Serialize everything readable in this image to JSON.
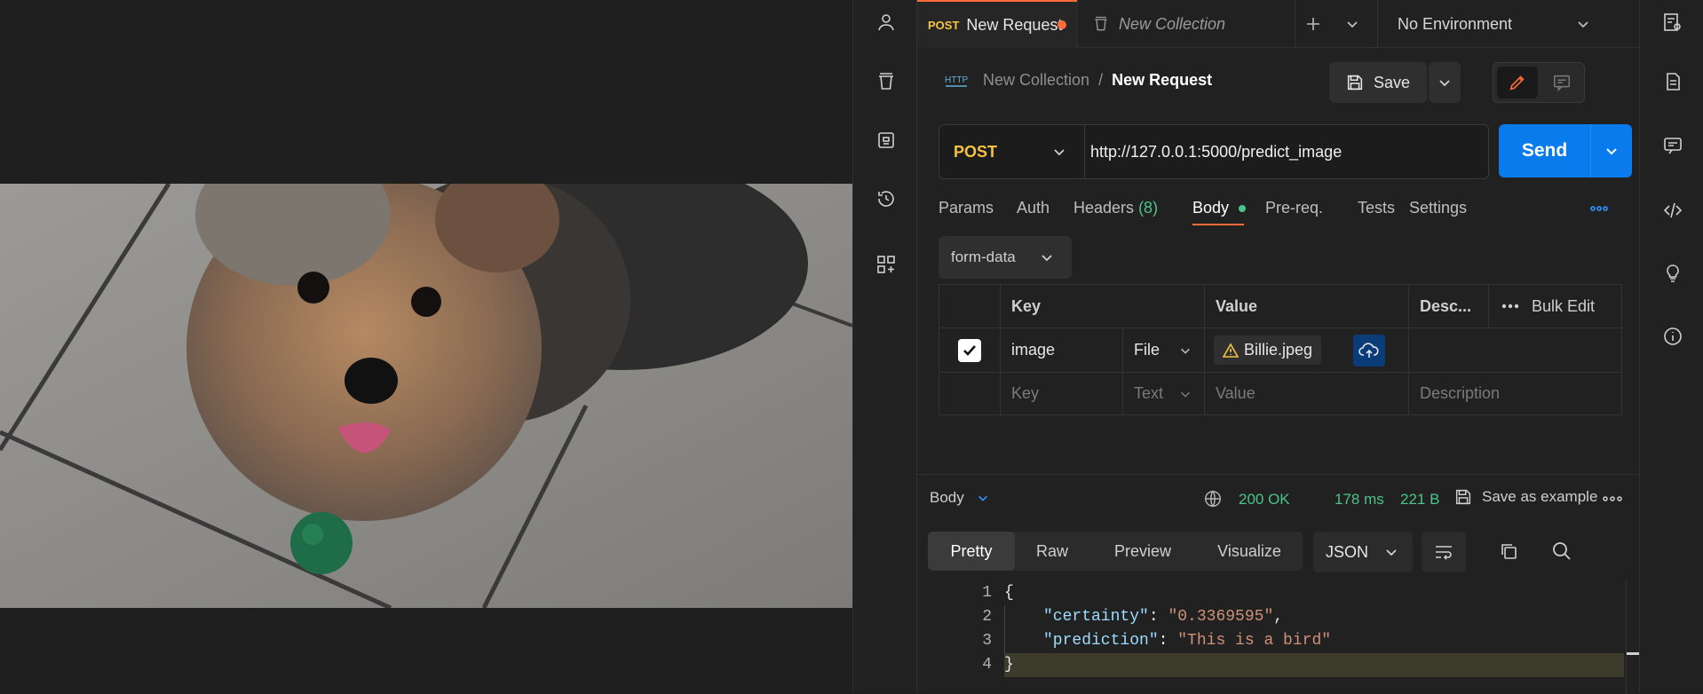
{
  "tabs": {
    "request_method": "POST",
    "request_name": "New Request",
    "collection_name": "New Collection",
    "environment": "No Environment"
  },
  "breadcrumb": {
    "collection": "New Collection",
    "separator": "/",
    "request": "New Request"
  },
  "toolbar": {
    "save_label": "Save"
  },
  "request": {
    "method": "POST",
    "url": "http://127.0.0.1:5000/predict_image",
    "send_label": "Send"
  },
  "request_tabs": {
    "params": "Params",
    "auth": "Auth",
    "headers": "Headers",
    "headers_count": "(8)",
    "body": "Body",
    "prereq": "Pre-req.",
    "tests": "Tests",
    "settings": "Settings"
  },
  "body_type": "form-data",
  "form_table": {
    "headers": {
      "key": "Key",
      "value": "Value",
      "desc": "Desc...",
      "bulk_edit": "Bulk Edit"
    },
    "rows": [
      {
        "key": "image",
        "type": "File",
        "value": "Billie.jpeg"
      }
    ],
    "placeholder": {
      "key": "Key",
      "type": "Text",
      "value": "Value",
      "desc": "Description"
    }
  },
  "response": {
    "label": "Body",
    "status": "200 OK",
    "time": "178 ms",
    "size": "221 B",
    "save_example": "Save as example",
    "view_tabs": [
      "Pretty",
      "Raw",
      "Preview",
      "Visualize"
    ],
    "format": "JSON",
    "lines": [
      "1",
      "2",
      "3",
      "4"
    ],
    "json": {
      "open": "{",
      "key1": "\"certainty\"",
      "val1": "\"0.3369595\"",
      "key2": "\"prediction\"",
      "val2": "\"This is a bird\"",
      "close": "}"
    }
  },
  "colors": {
    "accent": "#ff6c37",
    "send": "#097bed",
    "success": "#4cc38a",
    "json_key": "#9cdcfe",
    "json_string": "#ce9178"
  }
}
